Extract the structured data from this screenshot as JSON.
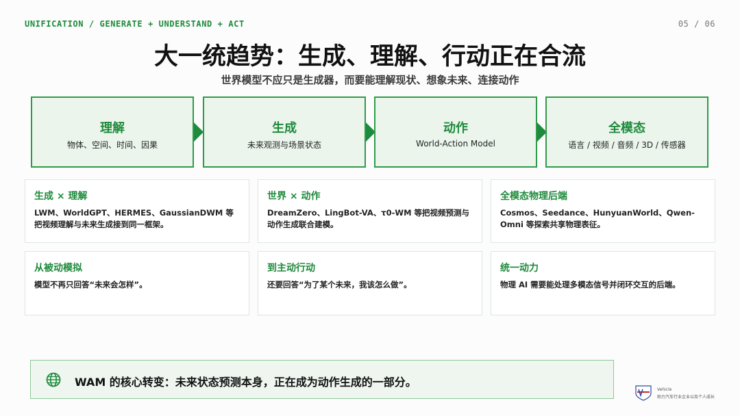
{
  "header": {
    "eyebrow": "UNIFICATION / GENERATE + UNDERSTAND + ACT",
    "page": "05 / 06"
  },
  "title": "大一统趋势：生成、理解、行动正在合流",
  "subtitle": "世界模型不应只是生成器，而要能理解现状、想象未来、连接动作",
  "flow": [
    {
      "title": "理解",
      "desc": "物体、空间、时间、因果"
    },
    {
      "title": "生成",
      "desc": "未来观测与场景状态"
    },
    {
      "title": "动作",
      "desc": "World-Action Model"
    },
    {
      "title": "全模态",
      "desc": "语言 / 视频 / 音频 / 3D / 传感器"
    }
  ],
  "cards": [
    {
      "title": "生成 × 理解",
      "body": "LWM、WorldGPT、HERMES、GaussianDWM 等把视频理解与未来生成接到同一框架。"
    },
    {
      "title": "世界 × 动作",
      "body": "DreamZero、LingBot-VA、τ0-WM 等把视频预测与动作生成联合建模。"
    },
    {
      "title": "全模态物理后端",
      "body": "Cosmos、Seedance、HunyuanWorld、Qwen-Omni 等探索共享物理表征。"
    },
    {
      "title": "从被动模拟",
      "body": "模型不再只回答“未来会怎样”。"
    },
    {
      "title": "到主动行动",
      "body": "还要回答“为了某个未来，我该怎么做”。"
    },
    {
      "title": "统一动力",
      "body": "物理 AI 需要能处理多模态信号并闭环交互的后端。"
    }
  ],
  "banner": {
    "icon": "globe-icon",
    "text": "WAM 的核心转变：未来状态预测本身，正在成为动作生成的一部分。"
  },
  "logo": {
    "name": "Vehicle",
    "tagline": "助力汽车行业企业以及个人成长"
  },
  "colors": {
    "accent": "#1e8a3c",
    "card_fill": "#ebf5ec",
    "card_border": "#2f9a4b",
    "banner_fill": "#eef6ef"
  }
}
